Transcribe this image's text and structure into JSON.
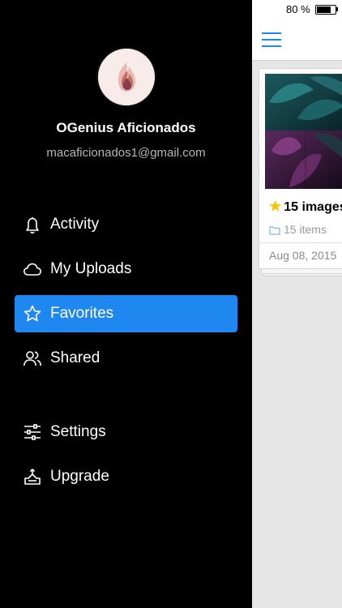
{
  "status_bar": {
    "battery_text": "80 %",
    "battery_level": 0.8
  },
  "profile": {
    "name": "OGenius Aficionados",
    "email": "macaficionados1@gmail.com"
  },
  "menu": {
    "items": [
      {
        "label": "Activity",
        "icon": "bell-icon",
        "active": false
      },
      {
        "label": "My Uploads",
        "icon": "cloud-icon",
        "active": false
      },
      {
        "label": "Favorites",
        "icon": "star-icon",
        "active": true
      },
      {
        "label": "Shared",
        "icon": "users-icon",
        "active": false
      },
      {
        "label": "Settings",
        "icon": "sliders-icon",
        "active": false
      },
      {
        "label": "Upgrade",
        "icon": "upgrade-icon",
        "active": false
      }
    ]
  },
  "collection_card": {
    "title": "15 images",
    "count": "15 items",
    "date": "Aug 08, 2015"
  },
  "colors": {
    "accent": "#1e87f0",
    "drawer_bg": "#000000",
    "star": "#f5c400"
  }
}
